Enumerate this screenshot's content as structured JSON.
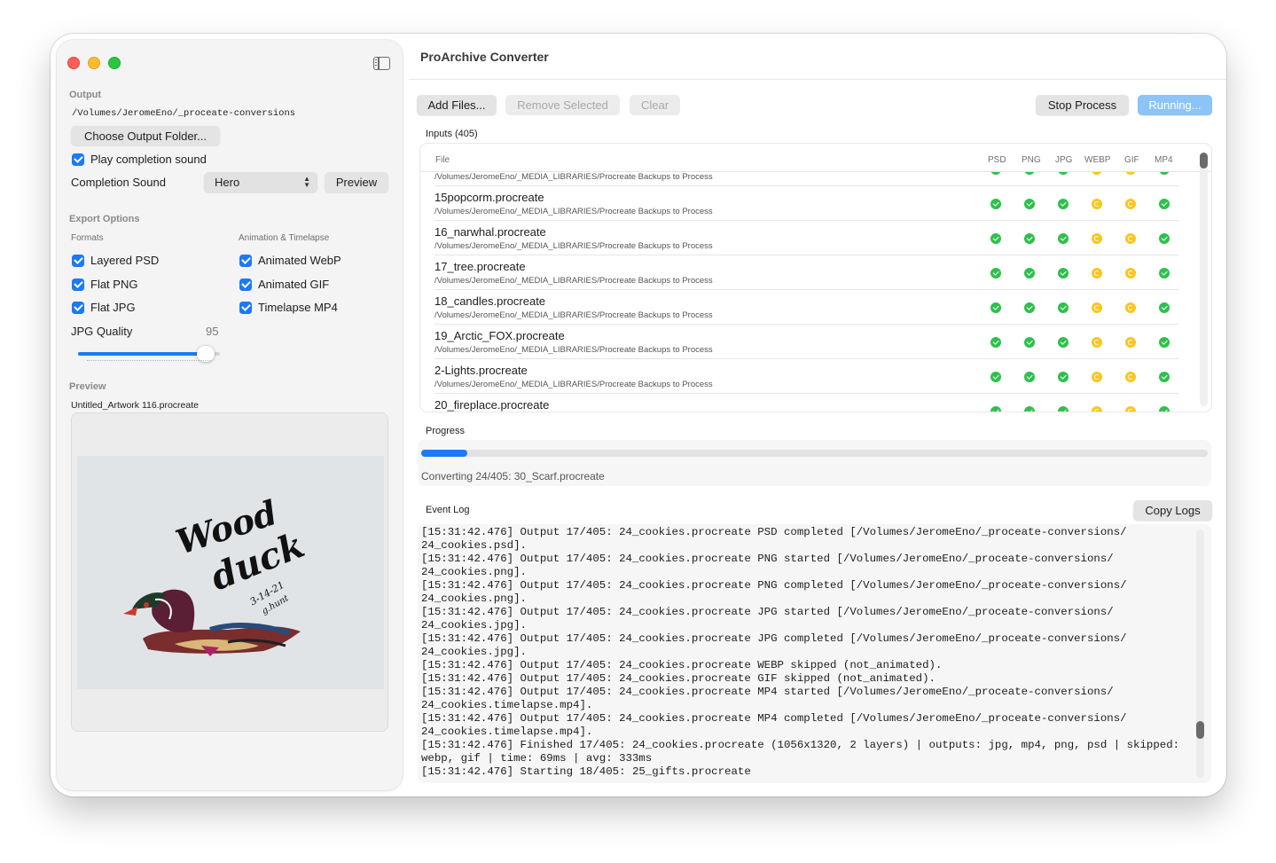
{
  "window": {
    "title": "ProArchive Converter"
  },
  "sidebar": {
    "output": {
      "section_title": "Output",
      "path": "/Volumes/JeromeEno/_proceate-conversions",
      "choose_folder_label": "Choose Output Folder...",
      "play_sound_label": "Play completion sound",
      "play_sound_checked": true,
      "completion_sound_label": "Completion Sound",
      "completion_sound_value": "Hero",
      "preview_button_label": "Preview"
    },
    "export_options": {
      "section_title": "Export Options",
      "formats_label": "Formats",
      "animation_label": "Animation & Timelapse",
      "formats": [
        {
          "label": "Layered PSD",
          "checked": true
        },
        {
          "label": "Flat PNG",
          "checked": true
        },
        {
          "label": "Flat JPG",
          "checked": true
        }
      ],
      "animation": [
        {
          "label": "Animated WebP",
          "checked": true
        },
        {
          "label": "Animated GIF",
          "checked": true
        },
        {
          "label": "Timelapse MP4",
          "checked": true
        }
      ],
      "jpg_quality_label": "JPG Quality",
      "jpg_quality_value": "95",
      "jpg_quality_fraction": 0.9
    },
    "preview": {
      "section_title": "Preview",
      "filename": "Untitled_Artwork 116.procreate",
      "artwork_text_1": "Wood",
      "artwork_text_2": "duck",
      "artwork_date": "3-14-21",
      "artwork_signature": "g.hunt"
    }
  },
  "toolbar": {
    "add_files": "Add Files...",
    "remove_selected": "Remove Selected",
    "clear": "Clear",
    "stop_process": "Stop Process",
    "running": "Running..."
  },
  "inputs": {
    "label": "Inputs (405)",
    "columns": [
      "File",
      "PSD",
      "PNG",
      "JPG",
      "WEBP",
      "GIF",
      "MP4"
    ],
    "rows": [
      {
        "name": "",
        "path": "/Volumes/JeromeEno/_MEDIA_LIBRARIES/Procreate Backups to Process",
        "status": [
          "ok",
          "ok",
          "ok",
          "skip",
          "skip",
          "ok"
        ]
      },
      {
        "name": "15popcorm.procreate",
        "path": "/Volumes/JeromeEno/_MEDIA_LIBRARIES/Procreate Backups to Process",
        "status": [
          "ok",
          "ok",
          "ok",
          "skip",
          "skip",
          "ok"
        ]
      },
      {
        "name": "16_narwhal.procreate",
        "path": "/Volumes/JeromeEno/_MEDIA_LIBRARIES/Procreate Backups to Process",
        "status": [
          "ok",
          "ok",
          "ok",
          "skip",
          "skip",
          "ok"
        ]
      },
      {
        "name": "17_tree.procreate",
        "path": "/Volumes/JeromeEno/_MEDIA_LIBRARIES/Procreate Backups to Process",
        "status": [
          "ok",
          "ok",
          "ok",
          "skip",
          "skip",
          "ok"
        ]
      },
      {
        "name": "18_candles.procreate",
        "path": "/Volumes/JeromeEno/_MEDIA_LIBRARIES/Procreate Backups to Process",
        "status": [
          "ok",
          "ok",
          "ok",
          "skip",
          "skip",
          "ok"
        ]
      },
      {
        "name": "19_Arctic_FOX.procreate",
        "path": "/Volumes/JeromeEno/_MEDIA_LIBRARIES/Procreate Backups to Process",
        "status": [
          "ok",
          "ok",
          "ok",
          "skip",
          "skip",
          "ok"
        ]
      },
      {
        "name": "2-Lights.procreate",
        "path": "/Volumes/JeromeEno/_MEDIA_LIBRARIES/Procreate Backups to Process",
        "status": [
          "ok",
          "ok",
          "ok",
          "skip",
          "skip",
          "ok"
        ]
      },
      {
        "name": "20_fireplace.procreate",
        "path": "",
        "status": [
          "ok",
          "ok",
          "ok",
          "skip",
          "skip",
          "ok"
        ]
      }
    ]
  },
  "progress": {
    "label": "Progress",
    "fraction": 0.059,
    "status_text": "Converting 24/405: 30_Scarf.procreate"
  },
  "event_log": {
    "label": "Event Log",
    "copy_button": "Copy Logs",
    "lines": [
      "[15:31:42.476] Output 17/405: 24_cookies.procreate PSD completed [/Volumes/JeromeEno/_proceate-conversions/",
      "24_cookies.psd].",
      "[15:31:42.476] Output 17/405: 24_cookies.procreate PNG started [/Volumes/JeromeEno/_proceate-conversions/",
      "24_cookies.png].",
      "[15:31:42.476] Output 17/405: 24_cookies.procreate PNG completed [/Volumes/JeromeEno/_proceate-conversions/",
      "24_cookies.png].",
      "[15:31:42.476] Output 17/405: 24_cookies.procreate JPG started [/Volumes/JeromeEno/_proceate-conversions/",
      "24_cookies.jpg].",
      "[15:31:42.476] Output 17/405: 24_cookies.procreate JPG completed [/Volumes/JeromeEno/_proceate-conversions/",
      "24_cookies.jpg].",
      "[15:31:42.476] Output 17/405: 24_cookies.procreate WEBP skipped (not_animated).",
      "[15:31:42.476] Output 17/405: 24_cookies.procreate GIF skipped (not_animated).",
      "[15:31:42.476] Output 17/405: 24_cookies.procreate MP4 started [/Volumes/JeromeEno/_proceate-conversions/",
      "24_cookies.timelapse.mp4].",
      "[15:31:42.476] Output 17/405: 24_cookies.procreate MP4 completed [/Volumes/JeromeEno/_proceate-conversions/",
      "24_cookies.timelapse.mp4].",
      "[15:31:42.476] Finished 17/405: 24_cookies.procreate (1056x1320, 2 layers) | outputs: jpg, mp4, png, psd | skipped:",
      "webp, gif | time: 69ms | avg: 333ms",
      "[15:31:42.476] Starting 18/405: 25_gifts.procreate"
    ]
  },
  "colors": {
    "accent": "#1b7af5",
    "ok": "#2ec04d",
    "skip": "#fbc51e",
    "running_button": "#8cc4f7"
  },
  "icons": {
    "window_close": "close-traffic-light",
    "window_minimize": "minimize-traffic-light",
    "window_zoom": "zoom-traffic-light",
    "sidebar_toggle": "sidebar-toggle-icon",
    "status_ok": "checkmark-circle-icon",
    "status_skip": "skip-circle-icon"
  }
}
